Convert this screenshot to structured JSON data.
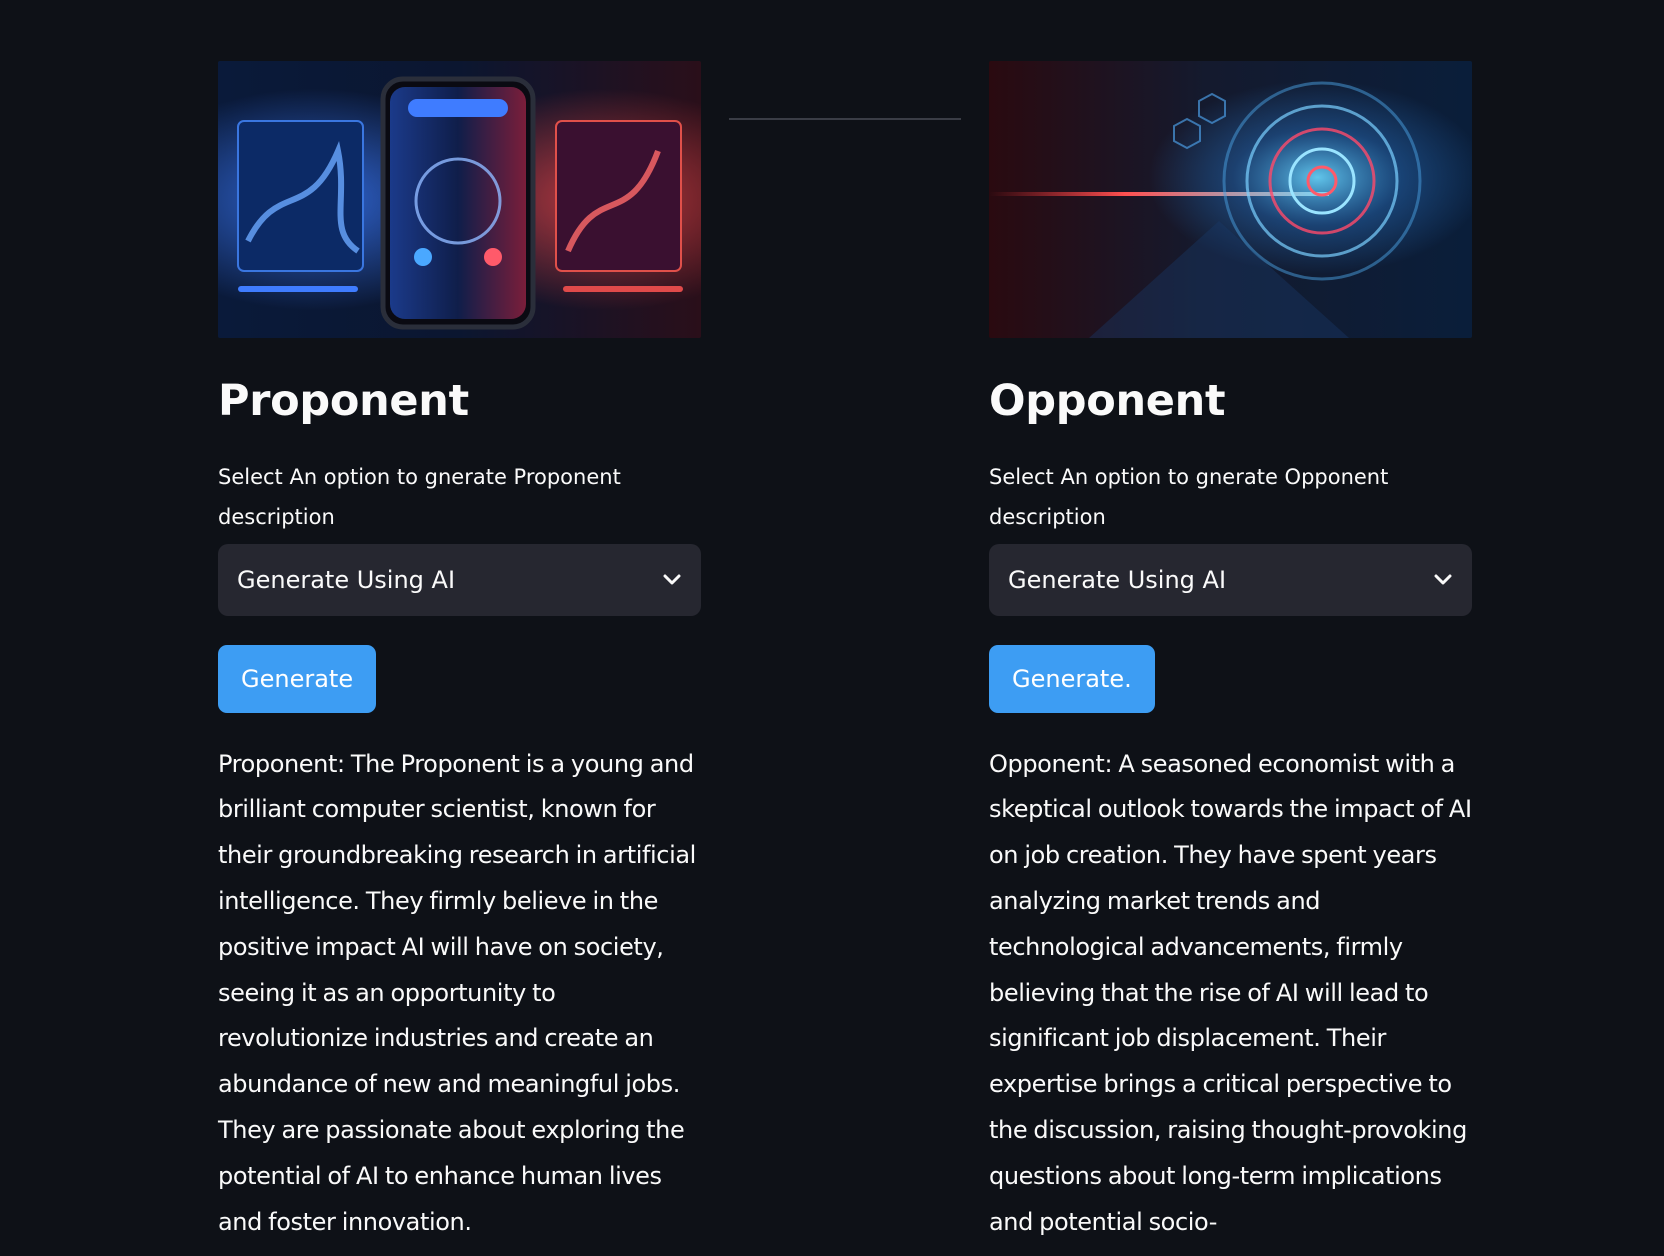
{
  "proponent": {
    "title": "Proponent",
    "select_label": "Select An option to gnerate Proponent description",
    "select_value": "Generate Using AI",
    "button_label": "Generate",
    "description": "Proponent: The Proponent is a young and brilliant computer scientist, known for their groundbreaking research in artificial intelligence. They firmly believe in the positive impact AI will have on society, seeing it as an opportunity to revolutionize industries and create an abundance of new and meaningful jobs. They are passionate about exploring the potential of AI to enhance human lives and foster innovation."
  },
  "opponent": {
    "title": "Opponent",
    "select_label": "Select An option to gnerate Opponent description",
    "select_value": "Generate Using AI",
    "button_label": "Generate.",
    "description": "Opponent: A seasoned economist with a skeptical outlook towards the impact of AI on job creation. They have spent years analyzing market trends and technological advancements, firmly believing that the rise of AI will lead to significant job displacement. Their expertise brings a critical perspective to the discussion, raising thought-provoking questions about long-term implications and potential socio-"
  },
  "colors": {
    "background": "#0e1117",
    "select_bg": "#262730",
    "button_bg": "#3d9df3",
    "text": "#fafafa"
  },
  "icons": {
    "select_chevron": "chevron-down-icon"
  }
}
